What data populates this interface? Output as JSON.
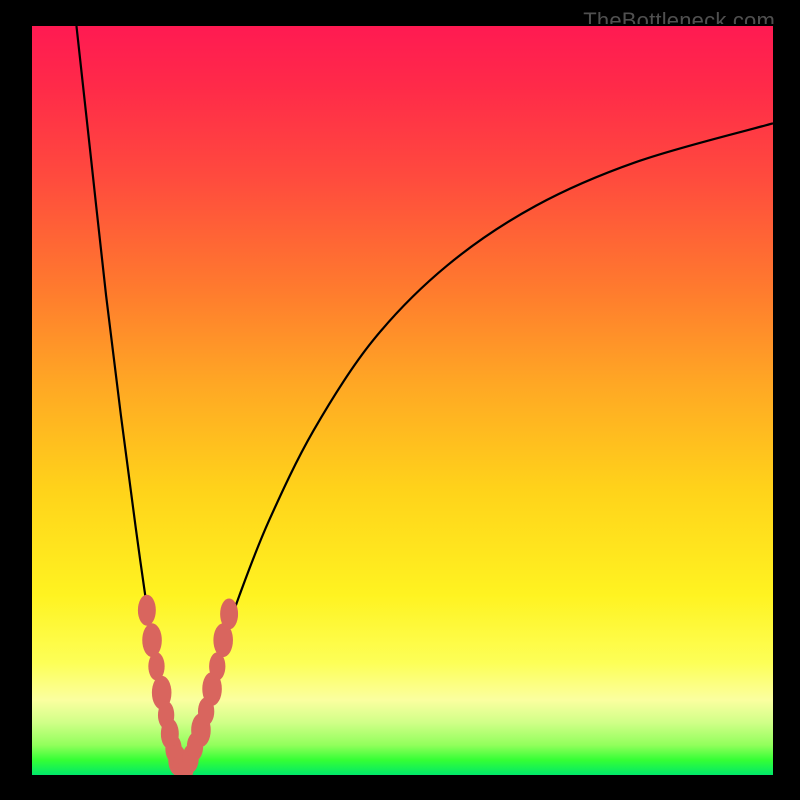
{
  "attribution": "TheBottleneck.com",
  "colors": {
    "background": "#000000",
    "curve": "#000000",
    "marker_fill": "#d9655e",
    "marker_stroke": "#b04a44"
  },
  "chart_data": {
    "type": "line",
    "title": "",
    "xlabel": "",
    "ylabel": "",
    "xlim": [
      0,
      100
    ],
    "ylim": [
      0,
      100
    ],
    "x_at_min": 20,
    "series": [
      {
        "name": "left-branch",
        "comment": "Steep descending curve from top-left frame edge down to the minimum near x≈20",
        "x": [
          6,
          8,
          10,
          12,
          14,
          16,
          17,
          18,
          19,
          20
        ],
        "y": [
          100,
          82,
          64,
          48,
          33,
          19,
          13,
          8,
          3,
          0
        ]
      },
      {
        "name": "right-branch",
        "comment": "Ascending concave curve from the minimum sweeping to the upper-right frame edge",
        "x": [
          20,
          22,
          24,
          26,
          28,
          32,
          38,
          46,
          56,
          68,
          82,
          100
        ],
        "y": [
          0,
          6,
          12,
          18,
          24,
          34,
          46,
          58,
          68,
          76,
          82,
          87
        ]
      }
    ],
    "markers": {
      "comment": "salmon rounded markers clustered along both branches near the bottom (roughly y ≤ 22)",
      "points": [
        {
          "x": 15.5,
          "y": 22,
          "r": 2.2
        },
        {
          "x": 16.2,
          "y": 18,
          "r": 2.4
        },
        {
          "x": 16.8,
          "y": 14.5,
          "r": 2.0
        },
        {
          "x": 17.5,
          "y": 11,
          "r": 2.4
        },
        {
          "x": 18.1,
          "y": 8,
          "r": 2.0
        },
        {
          "x": 18.6,
          "y": 5.5,
          "r": 2.2
        },
        {
          "x": 19.1,
          "y": 3.5,
          "r": 2.0
        },
        {
          "x": 19.6,
          "y": 2.0,
          "r": 2.2
        },
        {
          "x": 20.2,
          "y": 1.2,
          "r": 2.2
        },
        {
          "x": 20.8,
          "y": 1.2,
          "r": 2.0
        },
        {
          "x": 21.4,
          "y": 2.2,
          "r": 2.0
        },
        {
          "x": 22.0,
          "y": 3.8,
          "r": 2.0
        },
        {
          "x": 22.8,
          "y": 6.0,
          "r": 2.4
        },
        {
          "x": 23.5,
          "y": 8.5,
          "r": 2.0
        },
        {
          "x": 24.3,
          "y": 11.5,
          "r": 2.4
        },
        {
          "x": 25.0,
          "y": 14.5,
          "r": 2.0
        },
        {
          "x": 25.8,
          "y": 18.0,
          "r": 2.4
        },
        {
          "x": 26.6,
          "y": 21.5,
          "r": 2.2
        }
      ]
    }
  }
}
